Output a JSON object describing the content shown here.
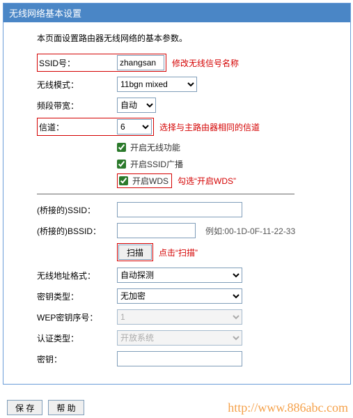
{
  "panel": {
    "title": "无线网络基本设置",
    "desc": "本页面设置路由器无线网络的基本参数。"
  },
  "ssid": {
    "label": "SSID号：",
    "value": "zhangsan",
    "annot": "修改无线信号名称"
  },
  "mode": {
    "label": "无线模式：",
    "value": "11bgn mixed"
  },
  "bandwidth": {
    "label": "频段带宽：",
    "value": "自动"
  },
  "channel": {
    "label": "信道：",
    "value": "6",
    "annot": "选择与主路由器相同的信道"
  },
  "checks": {
    "wireless": "开启无线功能",
    "ssid_broadcast": "开启SSID广播",
    "wds": "开启WDS",
    "wds_annot": "勾选“开启WDS”"
  },
  "bridge_ssid": {
    "label": "(桥接的)SSID：",
    "value": ""
  },
  "bridge_bssid": {
    "label": "(桥接的)BSSID：",
    "value": "",
    "hint": "例如:00-1D-0F-11-22-33"
  },
  "scan": {
    "label": "扫描",
    "annot": "点击“扫描”"
  },
  "addr_fmt": {
    "label": "无线地址格式：",
    "value": "自动探测"
  },
  "key_type": {
    "label": "密钥类型：",
    "value": "无加密"
  },
  "wep_index": {
    "label": "WEP密钥序号：",
    "value": "1"
  },
  "auth_type": {
    "label": "认证类型：",
    "value": "开放系统"
  },
  "key": {
    "label": "密钥：",
    "value": ""
  },
  "buttons": {
    "save": "保 存",
    "help": "帮 助"
  },
  "watermark": "http://www.886abc.com"
}
